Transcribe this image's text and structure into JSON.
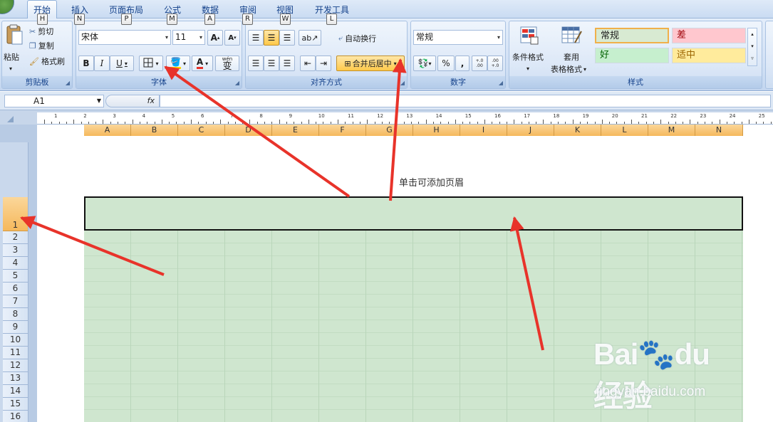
{
  "tabs": [
    {
      "label": "开始",
      "key": "H",
      "active": true
    },
    {
      "label": "插入",
      "key": "N"
    },
    {
      "label": "页面布局",
      "key": "P"
    },
    {
      "label": "公式",
      "key": "M"
    },
    {
      "label": "数据",
      "key": "A"
    },
    {
      "label": "审阅",
      "key": "R"
    },
    {
      "label": "视图",
      "key": "W"
    },
    {
      "label": "开发工具",
      "key": "L"
    }
  ],
  "clipboard": {
    "paste": "粘贴",
    "cut": "剪切",
    "copy": "复制",
    "format_painter": "格式刷",
    "label": "剪贴板"
  },
  "font": {
    "name": "宋体",
    "size": "11",
    "grow": "A",
    "shrink": "A",
    "bold": "B",
    "italic": "I",
    "underline": "U",
    "color_letter": "A",
    "phonetic": "wén",
    "phonetic_char": "变",
    "label": "字体"
  },
  "alignment": {
    "wrap": "自动换行",
    "merge": "合并后居中",
    "label": "对齐方式"
  },
  "number": {
    "format": "常规",
    "percent": "%",
    "comma": ",",
    "inc_decimal": "+.0 .00",
    "dec_decimal": ".00 +.0",
    "label": "数字"
  },
  "styles": {
    "conditional": "条件格式",
    "table_line1": "套用",
    "table_line2": "表格格式",
    "normal": "常规",
    "bad": "差",
    "good": "好",
    "neutral": "适中",
    "label": "样式",
    "colors": {
      "normal": "#d8ead2",
      "bad": "#ffc7ce",
      "good": "#c6efce",
      "neutral": "#ffeb9c"
    }
  },
  "formula_bar": {
    "cell_ref": "A1",
    "fx": "fx",
    "value": ""
  },
  "ruler": {
    "numbers": [
      "1",
      "2",
      "3",
      "4",
      "5",
      "6",
      "7",
      "8",
      "9",
      "10",
      "11",
      "12",
      "13",
      "14",
      "15",
      "16",
      "17",
      "18",
      "19",
      "20",
      "21",
      "22",
      "23",
      "24",
      "25"
    ]
  },
  "columns": [
    "A",
    "B",
    "C",
    "D",
    "E",
    "F",
    "G",
    "H",
    "I",
    "J",
    "K",
    "L",
    "M",
    "N"
  ],
  "rows": [
    "1",
    "2",
    "3",
    "4",
    "5",
    "6",
    "7",
    "8",
    "9",
    "10",
    "11",
    "12",
    "13",
    "14",
    "15",
    "16"
  ],
  "sheet": {
    "header_hint": "单击可添加页眉"
  },
  "watermark": {
    "logo": "Bai🐾du 经验",
    "url": "jingyan.baidu.com"
  },
  "accent_color": "#e8332a"
}
